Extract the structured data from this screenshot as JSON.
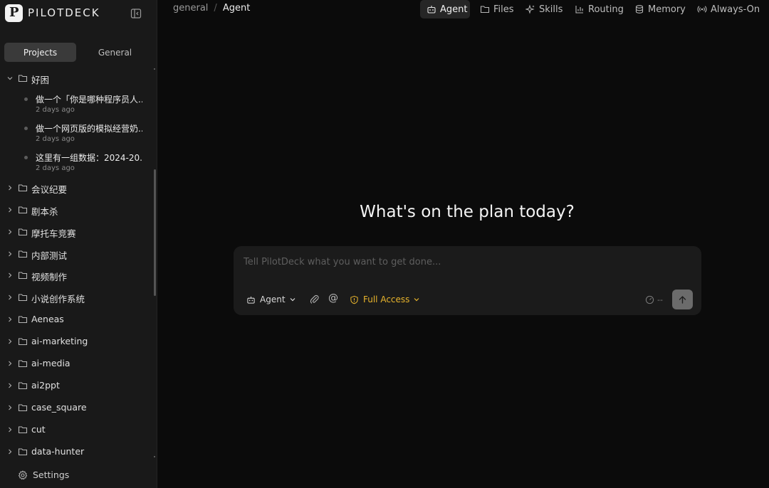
{
  "app": {
    "name": "PILOTDECK",
    "logo_letter": "P"
  },
  "sidebar": {
    "tabs": [
      {
        "label": "Projects",
        "active": true
      },
      {
        "label": "General",
        "active": false
      }
    ],
    "expanded_folder": {
      "label": "好困",
      "sessions": [
        {
          "title": "做一个「你是哪种程序员人...",
          "time": "2 days ago"
        },
        {
          "title": "做一个网页版的模拟经营奶...",
          "time": "2 days ago"
        },
        {
          "title": "这里有一组数据：2024-20...",
          "time": "2 days ago"
        }
      ]
    },
    "folders": [
      "会议纪要",
      "剧本杀",
      "摩托车竞赛",
      "内部测试",
      "视频制作",
      "小说创作系统",
      "Aeneas",
      "ai-marketing",
      "ai-media",
      "ai2ppt",
      "case_square",
      "cut",
      "data-hunter"
    ],
    "settings_label": "Settings"
  },
  "breadcrumb": {
    "parent": "general",
    "separator": "/",
    "current": "Agent"
  },
  "topnav": [
    {
      "label": "Agent",
      "icon": "bot-icon",
      "active": true
    },
    {
      "label": "Files",
      "icon": "folder-icon",
      "active": false
    },
    {
      "label": "Skills",
      "icon": "sparkle-icon",
      "active": false
    },
    {
      "label": "Routing",
      "icon": "bar-chart-icon",
      "active": false
    },
    {
      "label": "Memory",
      "icon": "database-icon",
      "active": false
    },
    {
      "label": "Always-On",
      "icon": "broadcast-icon",
      "active": false
    }
  ],
  "main": {
    "headline": "What's on the plan today?",
    "composer": {
      "placeholder": "Tell PilotDeck what you want to get done...",
      "mode_label": "Agent",
      "access_label": "Full Access",
      "usage_text": "--"
    }
  },
  "colors": {
    "accent_warning": "#e8b42c",
    "active_tab": "#3a3a3a",
    "background": "#0b0b0b",
    "sidebar": "#191919"
  }
}
